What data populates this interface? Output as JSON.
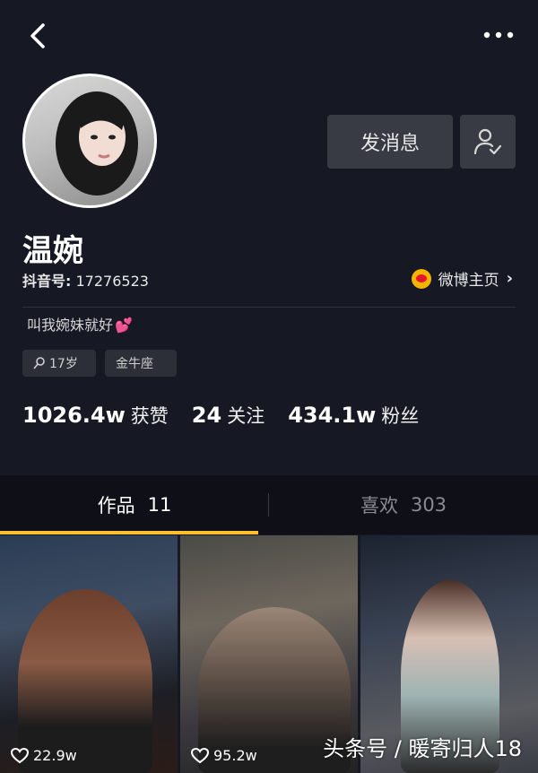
{
  "header": {
    "back_icon": "chevron-left-icon",
    "more_icon": "more-dots-icon"
  },
  "profile": {
    "name": "温婉",
    "douyin_id_label": "抖音号:",
    "douyin_id": "17276523",
    "weibo_label": "微博主页",
    "bio": "叫我婉妹就好",
    "tags": {
      "age": "17岁",
      "zodiac": "金牛座"
    }
  },
  "actions": {
    "message_label": "发消息",
    "follow_icon": "user-check-icon"
  },
  "stats": {
    "likes_num": "1026.4w",
    "likes_label": "获赞",
    "following_num": "24",
    "following_label": "关注",
    "fans_num": "434.1w",
    "fans_label": "粉丝"
  },
  "tabs": {
    "works_label": "作品",
    "works_count": "11",
    "likes_label": "喜欢",
    "likes_count": "303"
  },
  "videos": [
    {
      "likes": "22.9w"
    },
    {
      "likes": "95.2w"
    }
  ],
  "watermark": "头条号 / 暖寄归人18",
  "colors": {
    "background": "#161823",
    "accent": "#fbc02d",
    "button": "#393b44"
  }
}
